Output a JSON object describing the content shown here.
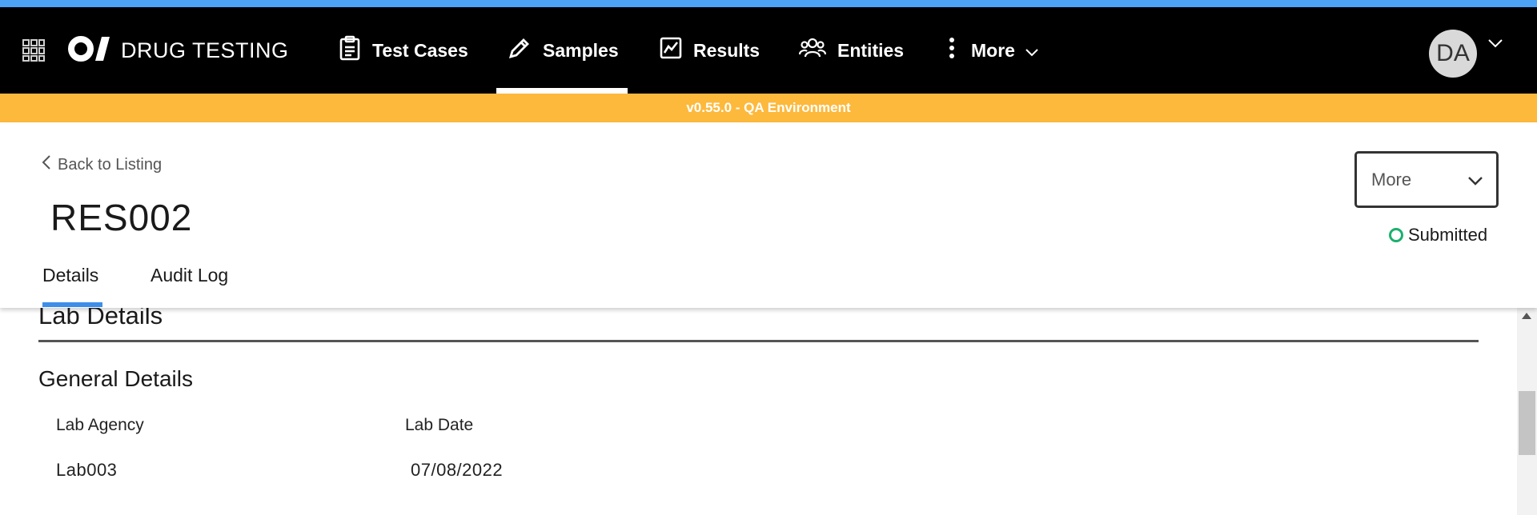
{
  "app": {
    "title": "DRUG TESTING",
    "logo_text": "O/"
  },
  "nav": {
    "items": [
      {
        "label": "Test Cases",
        "icon": "clipboard-icon"
      },
      {
        "label": "Samples",
        "icon": "pen-icon",
        "active": true
      },
      {
        "label": "Results",
        "icon": "chart-line-icon"
      },
      {
        "label": "Entities",
        "icon": "users-icon"
      },
      {
        "label": "More",
        "icon": "kebab-icon"
      }
    ]
  },
  "user": {
    "initials": "DA"
  },
  "environment_banner": "v0.55.0 - QA Environment",
  "header": {
    "back_label": "Back to Listing",
    "title": "RES002",
    "more_select": "More",
    "status": "Submitted"
  },
  "tabs": {
    "details": "Details",
    "audit_log": "Audit Log"
  },
  "content": {
    "section_title": "Lab Details",
    "subsection_title": "General Details",
    "fields": {
      "lab_agency_label": "Lab Agency",
      "lab_agency_value": "Lab003",
      "lab_date_label": "Lab Date",
      "lab_date_value": "07/08/2022"
    }
  },
  "colors": {
    "top_strip": "#4da3f5",
    "navbar": "#000000",
    "env_banner": "#fdb93c",
    "tab_active": "#3d8ee9",
    "status_submitted": "#1bb06e"
  }
}
